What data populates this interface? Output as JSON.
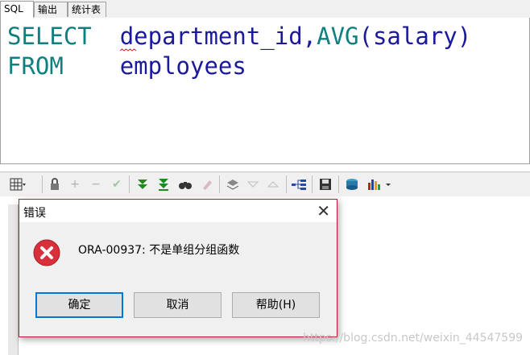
{
  "tabs": [
    {
      "label": "SQL"
    },
    {
      "label": "输出"
    },
    {
      "label": "统计表"
    }
  ],
  "editor": {
    "line1_kw": "SELECT",
    "line1_id": "department_id,",
    "line1_fn": "AVG",
    "line1_rest": "(salary)",
    "line2_kw": "FROM",
    "line2_id": "employees"
  },
  "toolbar": {
    "icons": [
      "grid-icon",
      "lock-icon",
      "plus-icon",
      "minus-icon",
      "check-icon",
      "fetch-next-icon",
      "fetch-last-icon",
      "find-icon",
      "clear-icon",
      "query-icon",
      "filter-icon",
      "sort-up-icon",
      "tree-icon",
      "save-icon",
      "export-icon",
      "chart-icon"
    ]
  },
  "dialog": {
    "title": "错误",
    "message": "ORA-00937: 不是单组分组函数",
    "ok_label": "确定",
    "cancel_label": "取消",
    "help_label": "帮助(H)",
    "accent": "#b02030"
  },
  "watermark": "https://blog.csdn.net/weixin_44547599"
}
